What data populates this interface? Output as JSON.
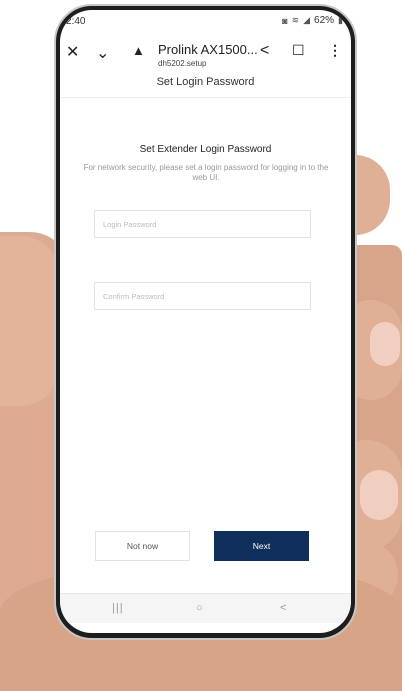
{
  "statusbar": {
    "time": "2:40",
    "battery": "62%",
    "icons": [
      "mute-icon",
      "wifi-icon",
      "signal-icon",
      "battery-icon"
    ]
  },
  "browser": {
    "title": "Prolink AX1500...",
    "url": "dh5202.setup",
    "icons": {
      "close": "✕",
      "chevron": "⌄",
      "warning": "▲",
      "share": "<",
      "bookmark": "☐",
      "menu": "⋮"
    }
  },
  "page": {
    "header": "Set Login Password",
    "title": "Set Extender Login Password",
    "description": "For network security, please set a login password for logging in to the web UI.",
    "login_placeholder": "Login Password",
    "confirm_placeholder": "Confirm Password",
    "not_now_label": "Not now",
    "next_label": "Next"
  },
  "navbar": {
    "recents": "|||",
    "home": "○",
    "back": "<"
  },
  "colors": {
    "accent": "#0f2e5a",
    "muted_text": "#999999"
  }
}
